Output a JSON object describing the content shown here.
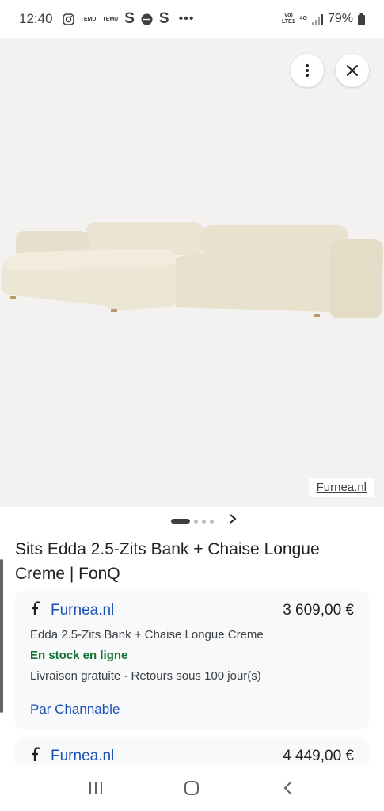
{
  "status_bar": {
    "time": "12:40",
    "notification_icons": [
      "instagram-icon",
      "temu-icon",
      "temu-icon",
      "s-icon",
      "app-icon",
      "s-icon"
    ],
    "temu_label": "TEMU",
    "s_label": "S",
    "more_label": "•••",
    "network_label_1": "Vo)",
    "network_label_2": "LTE1",
    "network_type": "4G",
    "battery": "79%"
  },
  "image": {
    "source_label": "Furnea.nl",
    "carousel": {
      "total": 4,
      "active_index": 0
    }
  },
  "product": {
    "title": "Sits Edda 2.5-Zits Bank + Chaise Longue Creme | FonQ"
  },
  "offers": [
    {
      "store": "Furnea.nl",
      "price": "3 609,00 €",
      "description": "Edda 2.5-Zits Bank + Chaise Longue Creme",
      "stock": "En stock en ligne",
      "shipping": "Livraison gratuite · Retours sous 100 jour(s)",
      "via": "Par Channable"
    },
    {
      "store": "Furnea.nl",
      "price": "4 449,00 €"
    }
  ],
  "colors": {
    "link": "#1a4fb5",
    "in_stock": "#137333",
    "image_bg": "#f3f2f1",
    "sofa": "#ece6d6"
  }
}
